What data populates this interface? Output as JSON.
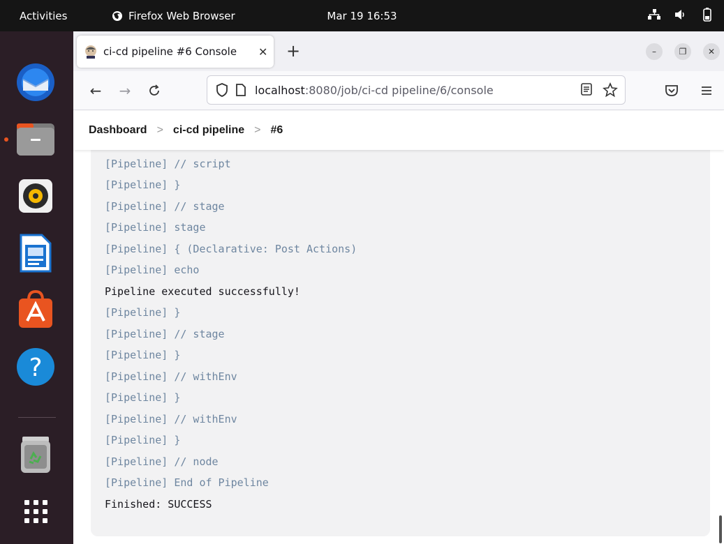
{
  "topbar": {
    "activities": "Activities",
    "app_name": "Firefox Web Browser",
    "datetime": "Mar 19  16:53"
  },
  "dock": {
    "items": [
      "thunderbird-mail",
      "files",
      "rhythmbox",
      "libreoffice-writer",
      "ubuntu-software",
      "help",
      "trash",
      "show-applications"
    ]
  },
  "browser": {
    "tab_title": "ci-cd pipeline #6 Console",
    "url_host": "localhost",
    "url_rest": ":8080/job/ci-cd pipeline/6/console"
  },
  "breadcrumb": {
    "items": [
      "Dashboard",
      "ci-cd pipeline",
      "#6"
    ]
  },
  "console": {
    "lines": [
      {
        "text": "[Pipeline] }",
        "kind": "pipe"
      },
      {
        "text": "[Pipeline] // script",
        "kind": "pipe"
      },
      {
        "text": "[Pipeline] }",
        "kind": "pipe"
      },
      {
        "text": "[Pipeline] // stage",
        "kind": "pipe"
      },
      {
        "text": "[Pipeline] stage",
        "kind": "pipe"
      },
      {
        "text": "[Pipeline] { (Declarative: Post Actions)",
        "kind": "pipe"
      },
      {
        "text": "[Pipeline] echo",
        "kind": "pipe"
      },
      {
        "text": "Pipeline executed successfully!",
        "kind": "out"
      },
      {
        "text": "[Pipeline] }",
        "kind": "pipe"
      },
      {
        "text": "[Pipeline] // stage",
        "kind": "pipe"
      },
      {
        "text": "[Pipeline] }",
        "kind": "pipe"
      },
      {
        "text": "[Pipeline] // withEnv",
        "kind": "pipe"
      },
      {
        "text": "[Pipeline] }",
        "kind": "pipe"
      },
      {
        "text": "[Pipeline] // withEnv",
        "kind": "pipe"
      },
      {
        "text": "[Pipeline] }",
        "kind": "pipe"
      },
      {
        "text": "[Pipeline] // node",
        "kind": "pipe"
      },
      {
        "text": "[Pipeline] End of Pipeline",
        "kind": "pipe"
      },
      {
        "text": "Finished: SUCCESS",
        "kind": "out"
      }
    ]
  },
  "colors": {
    "topbar_bg": "#151515",
    "dock_bg": "#2b1e26",
    "pipeline_text": "#6e86a0",
    "console_bg": "#f2f2f3",
    "accent": "#e95420"
  }
}
